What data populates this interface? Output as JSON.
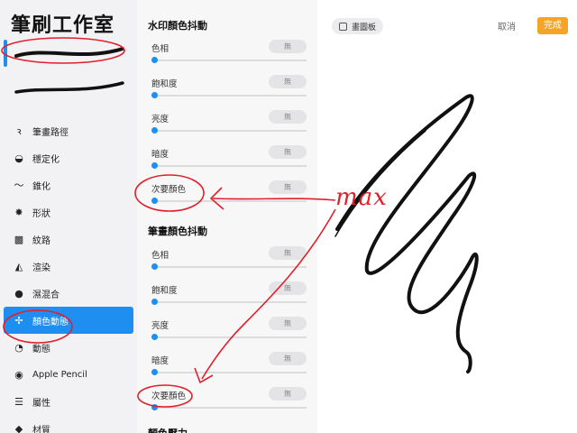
{
  "app": {
    "title": "筆刷工作室"
  },
  "brush_previews": [
    {
      "name": "brush-1",
      "selected": true
    },
    {
      "name": "brush-2",
      "selected": false
    }
  ],
  "nav": [
    {
      "label": "筆畫路徑",
      "icon": "stroke-path-icon",
      "glyph": "ꝛ",
      "active": false
    },
    {
      "label": "穩定化",
      "icon": "stabilization-icon",
      "glyph": "◒",
      "active": false
    },
    {
      "label": "錐化",
      "icon": "taper-icon",
      "glyph": "〜",
      "active": false
    },
    {
      "label": "形狀",
      "icon": "shape-icon",
      "glyph": "✸",
      "active": false
    },
    {
      "label": "紋路",
      "icon": "grain-icon",
      "glyph": "▩",
      "active": false
    },
    {
      "label": "渲染",
      "icon": "rendering-icon",
      "glyph": "◭",
      "active": false
    },
    {
      "label": "濕混合",
      "icon": "wet-mix-icon",
      "glyph": "💧",
      "active": false
    },
    {
      "label": "顏色動態",
      "icon": "color-dynamics-icon",
      "glyph": "✢",
      "active": true
    },
    {
      "label": "動態",
      "icon": "dynamics-icon",
      "glyph": "◔",
      "active": false
    },
    {
      "label": "Apple Pencil",
      "icon": "apple-pencil-icon",
      "glyph": "◉",
      "active": false
    },
    {
      "label": "屬性",
      "icon": "properties-icon",
      "glyph": "☰",
      "active": false
    },
    {
      "label": "材質",
      "icon": "materials-icon",
      "glyph": "◆",
      "active": false
    }
  ],
  "panel": {
    "section1": {
      "title": "水印顏色抖動",
      "rows": [
        {
          "label": "色相",
          "value": "無",
          "level": 0
        },
        {
          "label": "飽和度",
          "value": "無",
          "level": 0
        },
        {
          "label": "亮度",
          "value": "無",
          "level": 0
        },
        {
          "label": "暗度",
          "value": "無",
          "level": 0
        },
        {
          "label": "次要顏色",
          "value": "無",
          "level": 0
        }
      ]
    },
    "section2": {
      "title": "筆畫顏色抖動",
      "rows": [
        {
          "label": "色相",
          "value": "無",
          "level": 0
        },
        {
          "label": "飽和度",
          "value": "無",
          "level": 0
        },
        {
          "label": "亮度",
          "value": "無",
          "level": 0
        },
        {
          "label": "暗度",
          "value": "無",
          "level": 0
        },
        {
          "label": "次要顏色",
          "value": "無",
          "level": 0
        }
      ]
    },
    "section3": {
      "title": "顏色壓力"
    }
  },
  "canvas": {
    "drawpad_label": "畫圖板",
    "cancel_label": "取消",
    "done_label": "完成"
  },
  "annotation": {
    "text": "max"
  },
  "colors": {
    "accent": "#1f8ef1",
    "done": "#f5a425",
    "annotation": "#e0202a"
  }
}
